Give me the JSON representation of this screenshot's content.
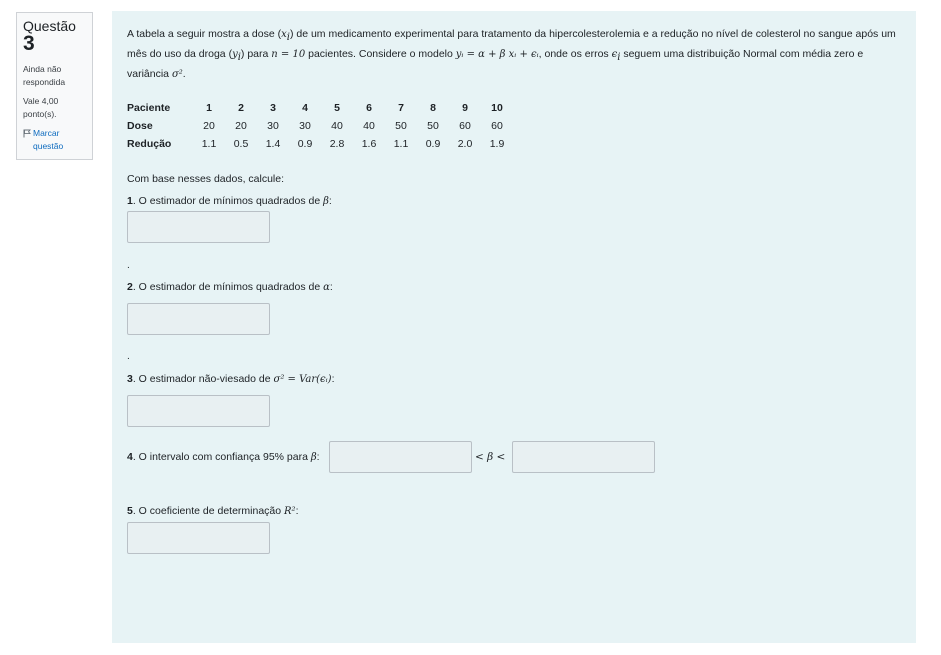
{
  "info": {
    "question_label": "Questão",
    "question_number": "3",
    "state": "Ainda não respondida",
    "grade": "Vale 4,00 ponto(s).",
    "flag_label": "Marcar questão"
  },
  "question": {
    "intro_1": "A tabela a seguir mostra a dose (",
    "x_i": "x",
    "intro_2": ") de um medicamento experimental para tratamento da hipercolesterolemia e a redução no nível de colesterol no sangue após um mês do uso da droga (",
    "y_i": "y",
    "intro_3": ") para ",
    "n_eq": "n = 10",
    "intro_4": " pacientes. Considere o modelo ",
    "model": "yᵢ = α + β xᵢ + ϵᵢ",
    "intro_5": ", onde os erros ",
    "eps": "ϵ",
    "intro_6": " seguem uma distribuição Normal com média zero e variância ",
    "sigma2": "σ²",
    "intro_7": ".",
    "sub_i": "i"
  },
  "table": {
    "row_labels": [
      "Paciente",
      "Dose",
      "Redução"
    ],
    "patients": [
      "1",
      "2",
      "3",
      "4",
      "5",
      "6",
      "7",
      "8",
      "9",
      "10"
    ],
    "dose": [
      "20",
      "20",
      "30",
      "30",
      "40",
      "40",
      "50",
      "50",
      "60",
      "60"
    ],
    "reduction": [
      "1.1",
      "0.5",
      "1.4",
      "0.9",
      "2.8",
      "1.6",
      "1.1",
      "0.9",
      "2.0",
      "1.9"
    ]
  },
  "prompt": "Com base nesses dados, calcule:",
  "items": [
    {
      "num": "1",
      "text": ". O estimador de mínimos quadrados de ",
      "sym": "β",
      "tail": ":"
    },
    {
      "num": "2",
      "text": ". O estimador de mínimos quadrados de ",
      "sym": "α",
      "tail": ":"
    },
    {
      "num": "3",
      "text": ". O estimador não-viesado de ",
      "sym": "σ² = Var(ϵᵢ)",
      "tail": ":"
    },
    {
      "num": "4",
      "text": ". O intervalo com confiança 95% para ",
      "sym": "β",
      "tail": ":",
      "between": "< β <"
    },
    {
      "num": "5",
      "text": ". O coeficiente de determinação ",
      "sym": "R²",
      "tail": ":"
    }
  ],
  "dot": ".",
  "answers": {
    "a1": "",
    "a2": "",
    "a3": "",
    "a4_low": "",
    "a4_high": "",
    "a5": ""
  }
}
